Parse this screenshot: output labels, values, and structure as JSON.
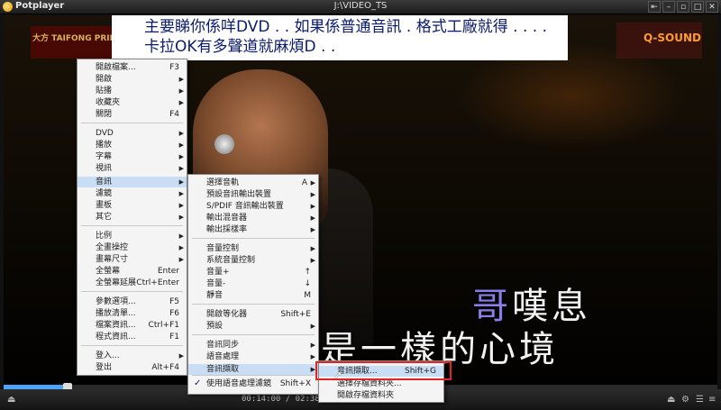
{
  "window": {
    "app_title": "Potplayer",
    "file_title": "J:\\VIDEO_TS",
    "buttons": [
      "⇤",
      "–",
      "▫",
      "□",
      "✕"
    ]
  },
  "annotation": {
    "line1": "主要睇你係咩DVD . . 如果係普通音訊 . 格式工廠就得 . . . .",
    "line2": "卡拉OK有多聲道就麻煩D . ."
  },
  "video": {
    "logo_left": "大方 TAIFONG PRIN",
    "logo_right": "Q-SOUND",
    "lyric1_highlight": "哥",
    "lyric1_rest": "嘆息",
    "lyric2": "是一樣的心境"
  },
  "menu_main": {
    "items": [
      {
        "label": "開啟檔案...",
        "shortcut": "F3"
      },
      {
        "label": "開啟",
        "arrow": true
      },
      {
        "label": "貼播",
        "arrow": true
      },
      {
        "label": "收藏夾",
        "arrow": true
      },
      {
        "label": "關閉",
        "shortcut": "F4"
      },
      {
        "label": "DVD",
        "arrow": true
      },
      {
        "label": "播放",
        "arrow": true
      },
      {
        "label": "字幕",
        "arrow": true
      },
      {
        "label": "視訊",
        "arrow": true
      },
      {
        "label": "音訊",
        "arrow": true
      },
      {
        "label": "濾鏡",
        "arrow": true
      },
      {
        "label": "畫板",
        "arrow": true
      },
      {
        "label": "其它",
        "arrow": true
      },
      {
        "label": "比例",
        "arrow": true
      },
      {
        "label": "全畫操控",
        "arrow": true
      },
      {
        "label": "畫幕尺寸",
        "arrow": true
      },
      {
        "label": "全螢幕",
        "shortcut": "Enter"
      },
      {
        "label": "全螢幕延展",
        "shortcut": "Ctrl+Enter"
      },
      {
        "label": "參數選項...",
        "shortcut": "F5"
      },
      {
        "label": "播放清單...",
        "shortcut": "F6"
      },
      {
        "label": "檔案資訊...",
        "shortcut": "Ctrl+F1"
      },
      {
        "label": "程式資訊...",
        "shortcut": "F1"
      },
      {
        "label": "登入...",
        "arrow": true
      },
      {
        "label": "登出",
        "shortcut": "Alt+F4"
      }
    ]
  },
  "menu_audio": {
    "items": [
      {
        "label": "選擇音軌",
        "shortcut": "A",
        "arrow": true
      },
      {
        "label": "預設音訊輸出裝置",
        "arrow": true
      },
      {
        "label": "S/PDIF 音訊輸出裝置",
        "arrow": true
      },
      {
        "label": "輸出混音器",
        "arrow": true
      },
      {
        "label": "輸出採樣率",
        "arrow": true
      },
      {
        "label": "音量控制",
        "arrow": true
      },
      {
        "label": "系統音量控制",
        "arrow": true
      },
      {
        "label": "音量+",
        "shortcut": "↑"
      },
      {
        "label": "音量-",
        "shortcut": "↓"
      },
      {
        "label": "靜音",
        "shortcut": "M"
      },
      {
        "label": "開啟等化器",
        "shortcut": "Shift+E"
      },
      {
        "label": "預設",
        "arrow": true
      },
      {
        "label": "音訊同步",
        "arrow": true
      },
      {
        "label": "語音處理",
        "arrow": true
      },
      {
        "label": "音訊擷取",
        "arrow": true
      },
      {
        "label": "使用語音處理濾鏡",
        "shortcut": "Shift+X",
        "checked": true
      }
    ]
  },
  "menu_capture": {
    "items": [
      {
        "label": "音訊擷取...",
        "shortcut": "Shift+G"
      },
      {
        "label": "選擇存檔資料夾..."
      },
      {
        "label": "開啟存檔資料夾"
      }
    ]
  },
  "controls": {
    "timecode": "00:14:00 / 02:38:13",
    "progress_fraction": 0.088
  }
}
